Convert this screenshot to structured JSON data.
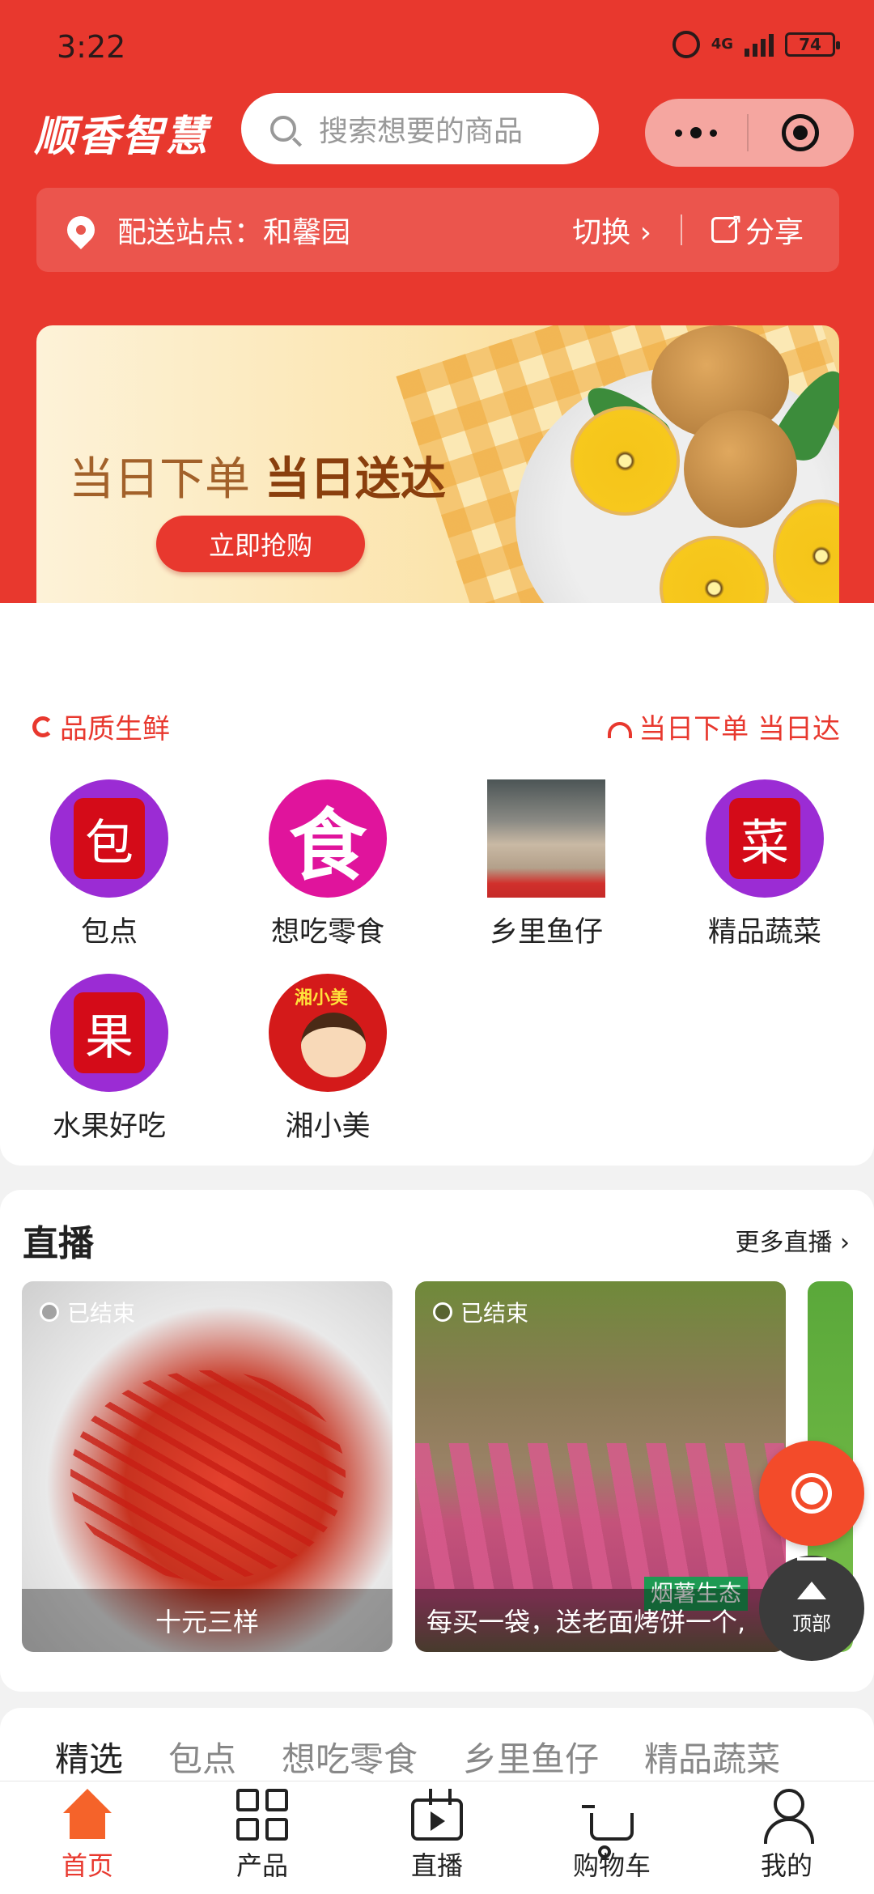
{
  "status_bar": {
    "time": "3:22",
    "network": "4G",
    "battery": "74"
  },
  "header": {
    "logo": "顺香智慧",
    "search_placeholder": "搜索想要的商品"
  },
  "station": {
    "label": "配送站点：和馨园",
    "switch_label": "切换 ›",
    "share_label": "分享"
  },
  "banner": {
    "headline_light": "当日下单",
    "headline_bold": "当日送达",
    "button": "立即抢购"
  },
  "features": {
    "left": "品质生鲜",
    "right": "当日下单 当日达"
  },
  "categories": [
    {
      "label": "包点",
      "glyph": "包"
    },
    {
      "label": "想吃零食",
      "glyph": "食"
    },
    {
      "label": "乡里鱼仔"
    },
    {
      "label": "精品蔬菜",
      "glyph": "菜"
    },
    {
      "label": "水果好吃",
      "glyph": "果"
    },
    {
      "label": "湘小美",
      "glyph": "湘小美"
    }
  ],
  "live": {
    "title": "直播",
    "more": "更多直播 ›",
    "items": [
      {
        "status": "已结束",
        "caption": "十元三样"
      },
      {
        "status": "已结束",
        "caption": "每买一袋，送老面烤饼一个,",
        "tag": "烟薯生态"
      }
    ]
  },
  "floating": {
    "top_label": "顶部"
  },
  "tabs": [
    "精选",
    "包点",
    "想吃零食",
    "乡里鱼仔",
    "精品蔬菜"
  ],
  "bottom_nav": [
    {
      "label": "首页",
      "icon": "home-icon"
    },
    {
      "label": "产品",
      "icon": "grid-icon"
    },
    {
      "label": "直播",
      "icon": "tv-icon"
    },
    {
      "label": "购物车",
      "icon": "cart-icon"
    },
    {
      "label": "我的",
      "icon": "user-icon"
    }
  ],
  "colors": {
    "brand_red": "#e8382e",
    "home_orange": "#f5632a"
  }
}
